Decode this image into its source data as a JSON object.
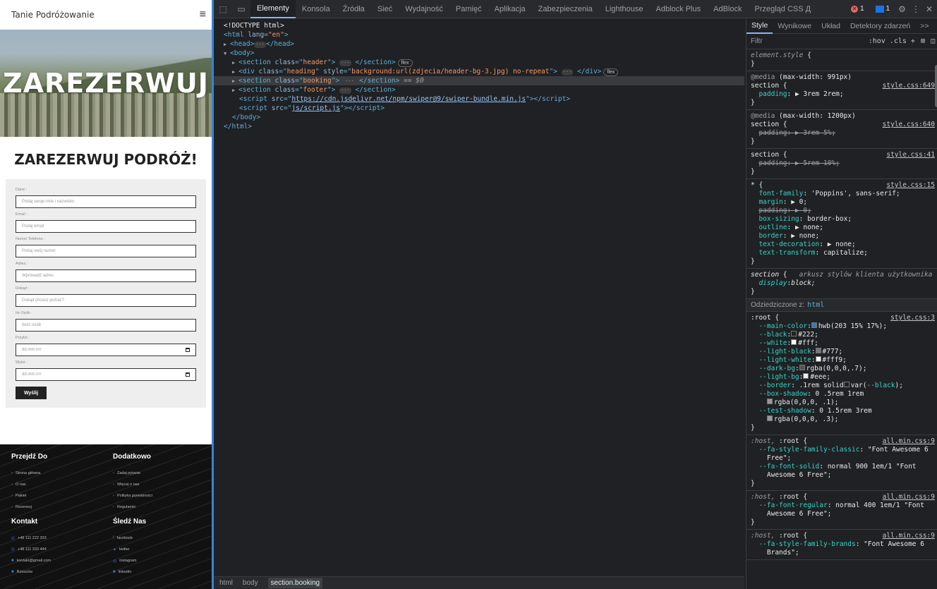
{
  "site": {
    "logo": "Tanie Podróżowanie",
    "menu_icon": "≡",
    "hero_title": "ZAREZERWUJ",
    "booking_title": "ZAREZERWUJ PODRÓŻ!",
    "fields": [
      {
        "label": "Dane :",
        "placeholder": "Podaj swoje imie i nazwisko"
      },
      {
        "label": "Email :",
        "placeholder": "Podaj email"
      },
      {
        "label": "Numer Telefonu :",
        "placeholder": "Podaj swój numer"
      },
      {
        "label": "Adres :",
        "placeholder": "Wprowadź adres"
      },
      {
        "label": "Dokąd :",
        "placeholder": "Dokąd chcesz jechać?"
      },
      {
        "label": "Ile Osób :",
        "placeholder": "Ilość osób"
      },
      {
        "label": "Przylot :",
        "placeholder": "dd.mm.rrrr"
      },
      {
        "label": "Wylot :",
        "placeholder": "dd.mm.rrrr"
      }
    ],
    "submit": "Wyślij",
    "footer": {
      "col1": {
        "title": "Przejdź Do",
        "links": [
          "Strona główna",
          "O nas",
          "Pakiet",
          "Rezerwuj"
        ]
      },
      "col2": {
        "title": "Dodatkowo",
        "links": [
          "Zadaj pytanie",
          "Więcej o nas",
          "Polityka prywatności",
          "Regulamin"
        ]
      },
      "col3": {
        "title": "Kontakt",
        "links": [
          "+48 111 222 333",
          "+48 111 333 444",
          "kontakt@gmail.com",
          "Rzeszów"
        ]
      },
      "col4": {
        "title": "Śledź Nas",
        "links": [
          "facebook",
          "twitter",
          "instagram",
          "linkedin"
        ]
      }
    }
  },
  "devtools": {
    "tabs": [
      "Elementy",
      "Konsola",
      "Źródła",
      "Sieć",
      "Wydajność",
      "Pamięć",
      "Aplikacja",
      "Zabezpieczenia",
      "Lighthouse",
      "Adblock Plus",
      "AdBlock",
      "Przegląd CSS Д"
    ],
    "active_tab": "Elementy",
    "error_count": "1",
    "issue_count": "1",
    "dom": {
      "doctype": "<!DOCTYPE html>",
      "html_open": "<html lang=\"en\">",
      "head": "<head>",
      "head_close": "</head>",
      "body": "<body>",
      "header_class": "header",
      "heading_class": "heading",
      "heading_style": "background:url(zdjecia/header-bg-3.jpg) no-repeat",
      "booking_class": "booking",
      "footer_class": "footer",
      "script1": "https://cdn.jsdelivr.net/npm/swiper@9/swiper-bundle.min.js",
      "script2": "js/script.js",
      "body_close": "</body>",
      "html_close": "</html>",
      "flex_badge": "flex",
      "sel_marker": "== $0"
    },
    "breadcrumbs": [
      "html",
      "body",
      "section.booking"
    ],
    "styles_tabs": [
      "Style",
      "Wynikowe",
      "Układ",
      "Detektory zdarzeń",
      ">>"
    ],
    "filter_placeholder": "Filtr",
    "filter_tools": ":hov  .cls  +",
    "inherited_label": "Odziedziczone z:",
    "inherited_from": "html"
  }
}
